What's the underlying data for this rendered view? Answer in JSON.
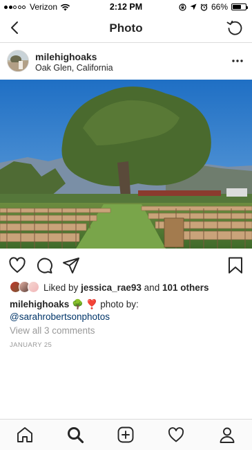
{
  "status_bar": {
    "carrier": "Verizon",
    "time": "2:12 PM",
    "battery": "66%",
    "battery_level": 0.66
  },
  "nav": {
    "title": "Photo"
  },
  "post": {
    "username": "milehighoaks",
    "location": "Oak Glen, California",
    "likes": {
      "prefix": "Liked by",
      "user": "jessica_rae93",
      "joiner": "and",
      "others": "101 others"
    },
    "caption": {
      "username": "milehighoaks",
      "emoji": "🌳 ❣️",
      "text": "photo by:",
      "mention": "@sarahrobertsonphotos"
    },
    "comments_link": "View all 3 comments",
    "date": "JANUARY 25"
  },
  "icons": {
    "back": "chevron-left-icon",
    "refresh": "refresh-icon",
    "more": "more-horizontal-icon",
    "like": "heart-icon",
    "comment": "comment-icon",
    "share": "paper-plane-icon",
    "save": "bookmark-icon",
    "tabs": [
      "home-icon",
      "search-icon",
      "add-post-icon",
      "activity-heart-icon",
      "profile-icon"
    ]
  }
}
